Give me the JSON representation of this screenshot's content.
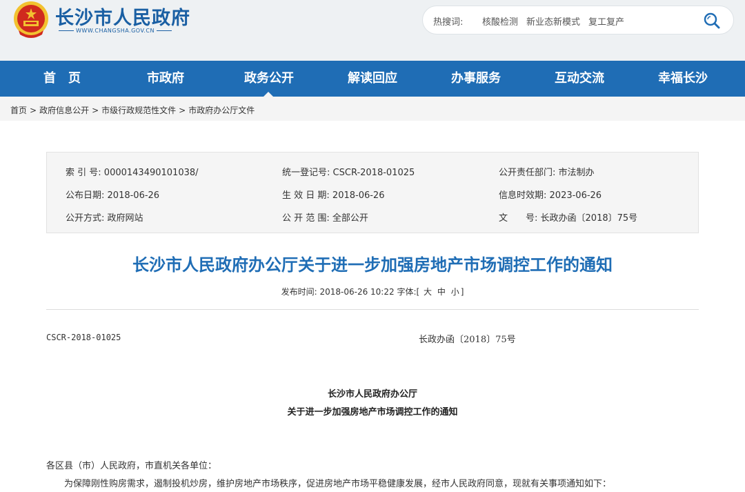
{
  "header": {
    "site_title": "长沙市人民政府",
    "site_url": "WWW.CHANGSHA.GOV.CN",
    "search": {
      "hot_label": "热搜词:",
      "hot_terms": [
        "核酸检测",
        "新业态新模式",
        "复工复产"
      ]
    }
  },
  "nav": {
    "items": [
      "首　页",
      "市政府",
      "政务公开",
      "解读回应",
      "办事服务",
      "互动交流",
      "幸福长沙"
    ],
    "active": "政务公开"
  },
  "breadcrumb": [
    "首页",
    "政府信息公开",
    "市级行政规范性文件",
    "市政府办公厅文件"
  ],
  "info": {
    "index_no_label": "索 引 号:",
    "index_no": "0000143490101038/",
    "reg_no_label": "统一登记号:",
    "reg_no": "CSCR-2018-01025",
    "dept_label": "公开责任部门:",
    "dept": "市法制办",
    "pub_date_label": "公布日期:",
    "pub_date": "2018-06-26",
    "eff_date_label": "生 效 日 期:",
    "eff_date": "2018-06-26",
    "valid_label": "信息时效期:",
    "valid": "2023-06-26",
    "method_label": "公开方式:",
    "method": "政府网站",
    "scope_label": "公 开 范 围:",
    "scope": "全部公开",
    "docno_label": "文　　号:",
    "docno": "长政办函〔2018〕75号"
  },
  "article": {
    "title": "长沙市人民政府办公厅关于进一步加强房地产市场调控工作的通知",
    "meta_label": "发布时间:",
    "meta_time": "2018-06-26 10:22",
    "font_label": "字体:",
    "font_open": "[",
    "font_sizes": [
      "大",
      "中",
      "小"
    ],
    "font_close": "]",
    "body": {
      "code": "CSCR-2018-01025",
      "docno": "长政办函〔2018〕75号",
      "heading1": "长沙市人民政府办公厅",
      "heading2": "关于进一步加强房地产市场调控工作的通知",
      "salutation": "各区县（市）人民政府，市直机关各单位：",
      "para1": "为保障刚性购房需求，遏制投机炒房，维护房地产市场秩序，促进房地产市场平稳健康发展，经市人民政府同意，现就有关事项通知如下："
    }
  },
  "colors": {
    "brand_blue": "#1f6db5",
    "header_bg": "#eef1f3",
    "emblem_red": "#d02a1e",
    "emblem_gold": "#f2c230"
  }
}
